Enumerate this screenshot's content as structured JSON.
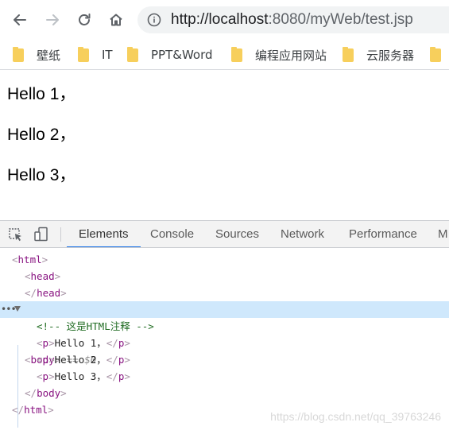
{
  "browser": {
    "url_host": "http://localhost",
    "url_rest": ":8080/myWeb/test.jsp",
    "bookmarks": [
      {
        "label": "壁纸"
      },
      {
        "label": "IT"
      },
      {
        "label": "PPT&Word"
      },
      {
        "label": "编程应用网站"
      },
      {
        "label": "云服务器"
      }
    ]
  },
  "page": {
    "lines": [
      "Hello 1，",
      "Hello 2，",
      "Hello 3，"
    ]
  },
  "devtools": {
    "tabs": [
      "Elements",
      "Console",
      "Sources",
      "Network",
      "Performance",
      "M"
    ],
    "active_tab": "Elements",
    "tree": {
      "html_tag": "html",
      "head_tag": "head",
      "body_tag": "body",
      "selected_suffix": "== $0",
      "comment": "<!-- 这是HTML注释 -->",
      "p_tag": "p",
      "p_texts": [
        "Hello 1，",
        "Hello 2，",
        "Hello 3，"
      ]
    }
  },
  "watermark": "https://blog.csdn.net/qq_39763246",
  "colors": {
    "accent": "#1a73e8",
    "selected_row": "#cfe8fc",
    "tag": "#881280",
    "comment": "#236e25",
    "folder": "#f7cf5c"
  }
}
